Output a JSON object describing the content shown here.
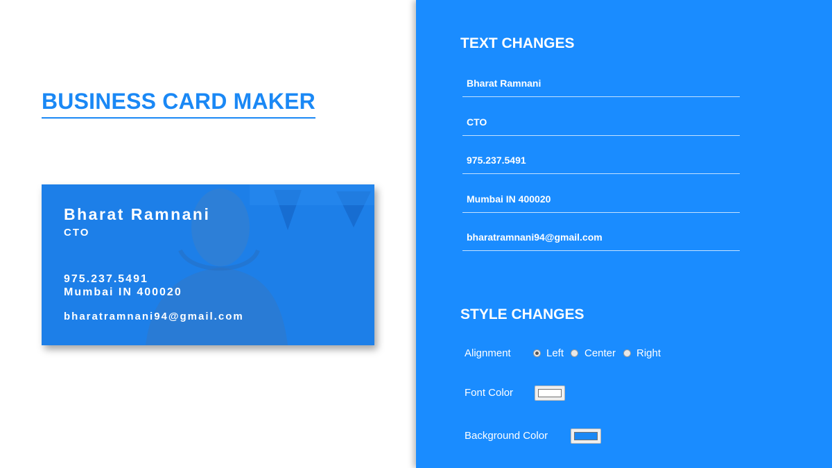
{
  "page": {
    "title": "BUSINESS CARD MAKER"
  },
  "card": {
    "name": "Bharat Ramnani",
    "role": "CTO",
    "phone": "975.237.5491",
    "address": "Mumbai IN 400020",
    "email": "bharatramnani94@gmail.com",
    "background_color": "#1d7fe8",
    "font_color": "#ffffff"
  },
  "text_changes": {
    "title": "TEXT CHANGES",
    "fields": {
      "name": "Bharat Ramnani",
      "role": "CTO",
      "phone": "975.237.5491",
      "address": "Mumbai IN 400020",
      "email": "bharatramnani94@gmail.com"
    }
  },
  "style_changes": {
    "title": "STYLE CHANGES",
    "alignment_label": "Alignment",
    "alignment_options": [
      "Left",
      "Center",
      "Right"
    ],
    "alignment_selected": "Left",
    "font_color_label": "Font Color",
    "font_color_value": "#ffffff",
    "background_color_label": "Background Color",
    "background_color_value": "#1a88f5"
  },
  "colors": {
    "panel_bg": "#1a8cff",
    "accent": "#1a88f5"
  }
}
